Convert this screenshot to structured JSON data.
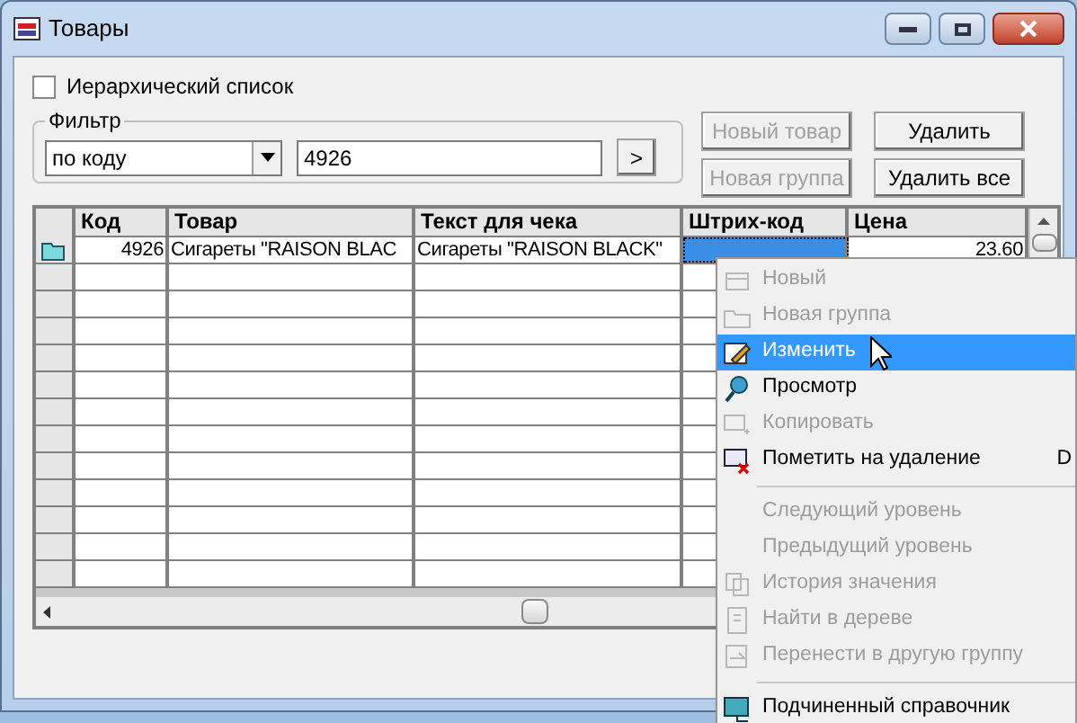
{
  "window": {
    "title": "Товары"
  },
  "hierarchical_list": {
    "label": "Иерархический список",
    "checked": false
  },
  "filter": {
    "legend": "Фильтр",
    "mode": "по коду",
    "value": "4926",
    "apply_button": ">"
  },
  "buttons": [
    {
      "label": "Новый товар",
      "disabled": true
    },
    {
      "label": "Удалить",
      "disabled": false
    },
    {
      "label": "Новая группа",
      "disabled": true
    },
    {
      "label": "Удалить все",
      "disabled": false
    }
  ],
  "table": {
    "columns": [
      "Код",
      "Товар",
      "Текст для чека",
      "Штрих-код",
      "Цена"
    ],
    "rows": [
      {
        "cells": [
          "4926",
          "Сигареты \"RAISON BLAC",
          "Сигареты \"RAISON BLACK\"",
          "",
          "23.60"
        ]
      }
    ]
  },
  "context_menu": [
    {
      "label": "Новый",
      "disabled": true,
      "selected": false
    },
    {
      "label": "Новая группа",
      "disabled": true,
      "selected": false
    },
    {
      "label": "Изменить",
      "disabled": false,
      "selected": true
    },
    {
      "label": "Просмотр",
      "disabled": false,
      "selected": false
    },
    {
      "label": "Копировать",
      "disabled": true,
      "selected": false
    },
    {
      "label": "Пометить на удаление",
      "disabled": false,
      "selected": false,
      "shortcut": "D"
    },
    {
      "kind": "separator"
    },
    {
      "label": "Следующий уровень",
      "disabled": true,
      "selected": false
    },
    {
      "label": "Предыдущий уровень",
      "disabled": true,
      "selected": false
    },
    {
      "label": "История значения",
      "disabled": true,
      "selected": false
    },
    {
      "label": "Найти в дереве",
      "disabled": true,
      "selected": false
    },
    {
      "label": "Перенести в другую группу",
      "disabled": true,
      "selected": false
    },
    {
      "kind": "separator"
    },
    {
      "label": "Подчиненный справочник",
      "disabled": false,
      "selected": false
    }
  ]
}
